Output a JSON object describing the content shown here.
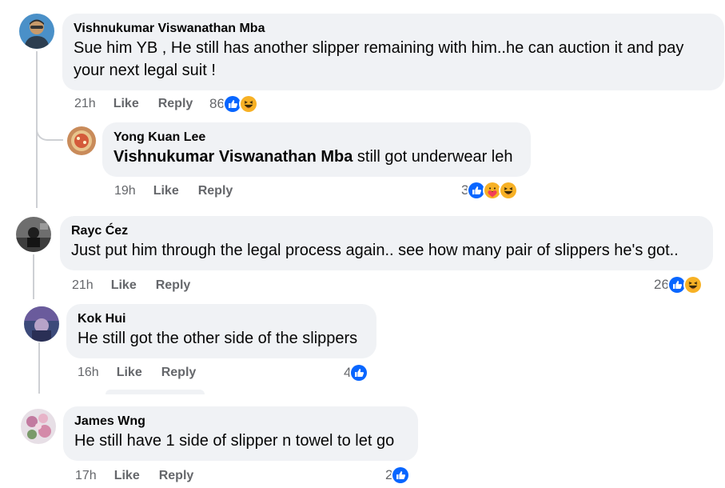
{
  "comments": [
    {
      "author": "Vishnukumar Viswanathan Mba",
      "text": "Sue him YB , He still has another slipper remaining with him..he can auction it and pay your next legal suit !",
      "time": "21h",
      "like_label": "Like",
      "reply_label": "Reply",
      "reaction_count": "86",
      "reactions": [
        "like-icon",
        "haha-icon"
      ]
    },
    {
      "author": "Yong Kuan Lee",
      "mention": "Vishnukumar Viswanathan Mba",
      "text": "still got underwear leh",
      "time": "19h",
      "like_label": "Like",
      "reply_label": "Reply",
      "reaction_count": "3",
      "reactions": [
        "like-icon",
        "care-icon",
        "haha-icon"
      ]
    },
    {
      "author": "Rayc Ćez",
      "text": "Just put him through the legal process again.. see how many pair of slippers he's got..",
      "time": "21h",
      "like_label": "Like",
      "reply_label": "Reply",
      "reaction_count": "26",
      "reactions": [
        "like-icon",
        "haha-icon"
      ]
    },
    {
      "author": "Kok Hui",
      "text": "He still got the other side of the slippers",
      "time": "16h",
      "like_label": "Like",
      "reply_label": "Reply",
      "reaction_count": "4",
      "reactions": [
        "like-icon"
      ]
    },
    {
      "author": "James Wng",
      "text": "He still have 1 side of slipper n towel to let go",
      "time": "17h",
      "like_label": "Like",
      "reply_label": "Reply",
      "reaction_count": "2",
      "reactions": [
        "like-icon"
      ]
    }
  ],
  "colors": {
    "bubble": "#f0f2f5",
    "meta_text": "#65676b",
    "like_blue": "#0866ff",
    "haha_yellow": "#f7b125"
  }
}
